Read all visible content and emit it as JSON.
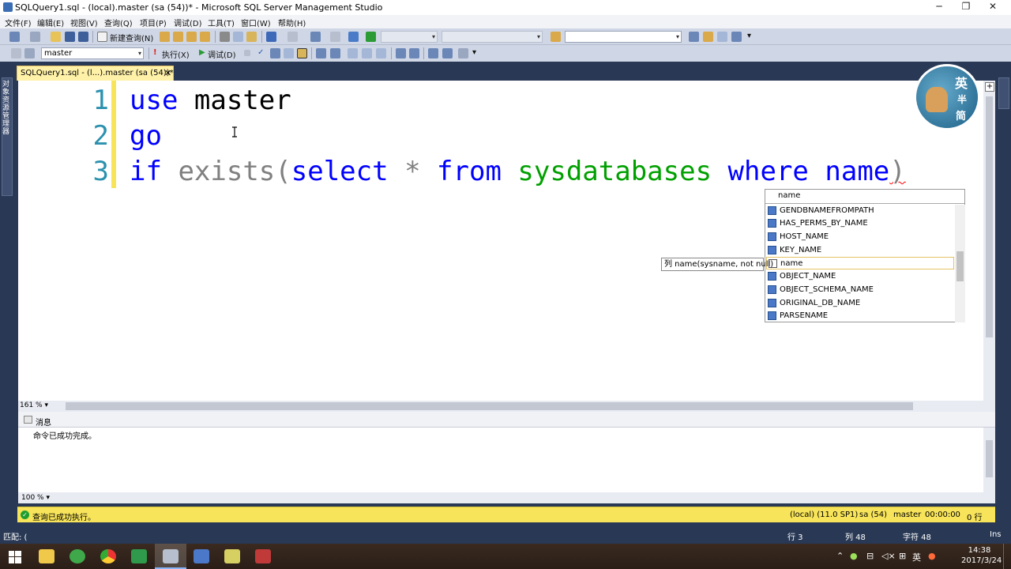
{
  "window": {
    "title": "SQLQuery1.sql - (local).master (sa (54))* - Microsoft SQL Server Management Studio",
    "minimize": "─",
    "restore": "❐",
    "close": "✕"
  },
  "menu": [
    "文件(F)",
    "编辑(E)",
    "视图(V)",
    "查询(Q)",
    "项目(P)",
    "调试(D)",
    "工具(T)",
    "窗口(W)",
    "帮助(H)"
  ],
  "toolbar1": {
    "new_query": "新建查询(N)"
  },
  "toolbar2": {
    "database": "master",
    "execute": "执行(X)",
    "debug": "调试(D)"
  },
  "left_panel_label": "对象资源管理器",
  "tab": {
    "title": "SQLQuery1.sql - (l...).master (sa (54))*",
    "close": "✕"
  },
  "editor": {
    "line_numbers": [
      "1",
      "2",
      "3"
    ],
    "line1": {
      "kw1": "use",
      "ident": "master"
    },
    "line2": {
      "kw": "go"
    },
    "line3": {
      "kw_if": "if",
      "exists": "exists",
      "paren": "(",
      "select": "select",
      "star": "*",
      "from": "from",
      "table": "sysdatabases",
      "where": "where",
      "col": "name",
      "close": ")"
    },
    "zoom": "161 %"
  },
  "autocomplete": {
    "query": "name",
    "items": [
      "GENDBNAMEFROMPATH",
      "HAS_PERMS_BY_NAME",
      "HOST_NAME",
      "KEY_NAME",
      "name",
      "OBJECT_NAME",
      "OBJECT_SCHEMA_NAME",
      "ORIGINAL_DB_NAME",
      "PARSENAME"
    ],
    "selected_index": 4,
    "tooltip": "列 name(sysname, not null)"
  },
  "results": {
    "tab_label": "消息",
    "message": "命令已成功完成。",
    "zoom": "100 %"
  },
  "status": {
    "text": "查询已成功执行。",
    "server": "(local) (11.0 SP1)",
    "user": "sa (54)",
    "database": "master",
    "elapsed": "00:00:00",
    "rows": "0 行"
  },
  "app_status": {
    "left": "匹配: (",
    "row": "行 3",
    "col": "列 48",
    "char": "字符 48",
    "mode": "Ins"
  },
  "taskbar": {
    "time": "14:38",
    "date": "2017/3/24",
    "ime": "英"
  },
  "colors": {
    "keyword": "#0000ff",
    "function": "#ff00ff",
    "system_table": "#00a000",
    "line_number": "#2b91af",
    "status_bar": "#f7e45a"
  }
}
